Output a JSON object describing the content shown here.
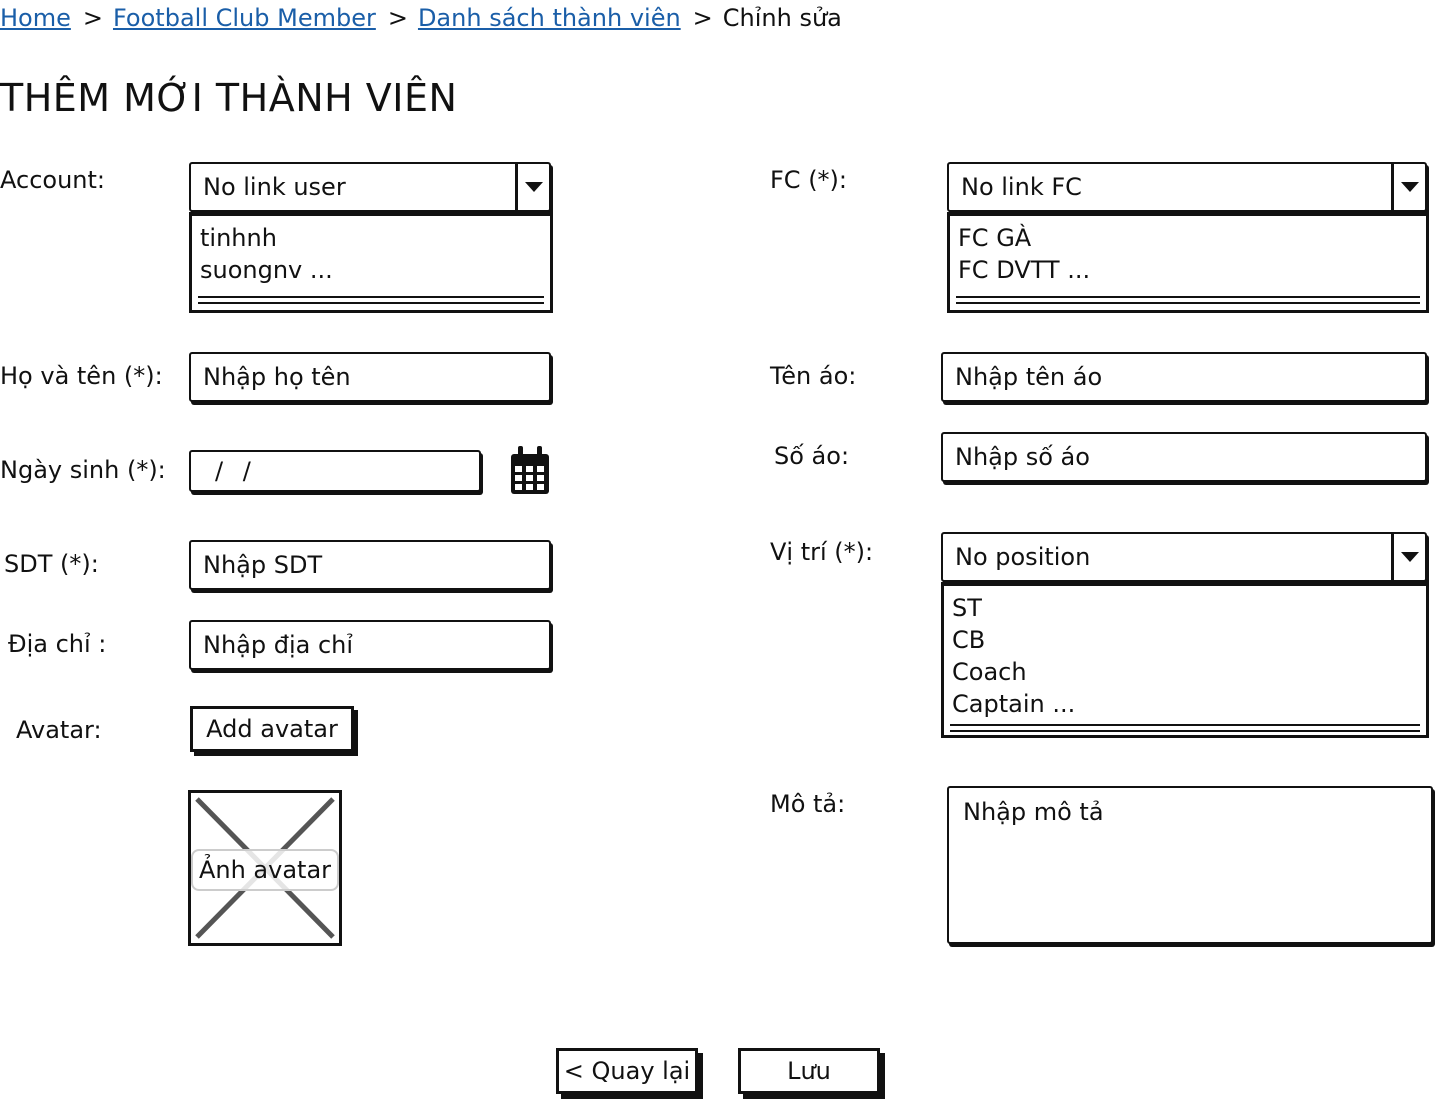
{
  "breadcrumb": {
    "home": "Home",
    "club": "Football Club Member",
    "list": "Danh sách thành viên",
    "current": "Chỉnh sửa",
    "separator": ">"
  },
  "page_title": "THÊM MỚI THÀNH VIÊN",
  "account": {
    "label": "Account:",
    "selected": "No link user",
    "options": [
      "tinhnh",
      "suongnv ..."
    ]
  },
  "fullname": {
    "label": "Họ và tên (*):",
    "placeholder": "Nhập họ tên"
  },
  "birthday": {
    "label": "Ngày sinh (*):",
    "value": "/ /",
    "icon": "calendar-icon"
  },
  "phone": {
    "label": "SDT (*):",
    "placeholder": "Nhập SDT"
  },
  "address": {
    "label": "Địa chỉ :",
    "placeholder": "Nhập địa chỉ"
  },
  "avatar": {
    "label": "Avatar:",
    "add_button": "Add avatar",
    "image_caption": "Ảnh avatar"
  },
  "fc": {
    "label": "FC (*):",
    "selected": "No link FC",
    "options": [
      "FC GÀ",
      "FC DVTT ..."
    ]
  },
  "shirt_name": {
    "label": "Tên áo:",
    "placeholder": "Nhập tên áo"
  },
  "shirt_number": {
    "label": "Số áo:",
    "placeholder": "Nhập số áo"
  },
  "position": {
    "label": "Vị trí (*):",
    "selected": "No position",
    "options": [
      "ST",
      "CB",
      "Coach",
      "Captain ..."
    ]
  },
  "description": {
    "label": "Mô tả:",
    "placeholder": "Nhập mô tả"
  },
  "actions": {
    "back": "< Quay lại",
    "save": "Lưu"
  },
  "colors": {
    "link": "#1a5ea8",
    "ink": "#111111"
  }
}
